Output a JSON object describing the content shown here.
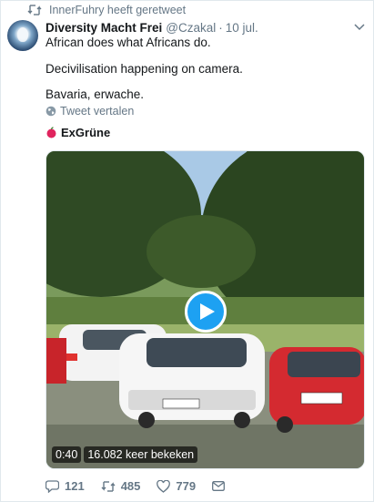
{
  "context": {
    "text": "InnerFuhry heeft geretweet",
    "icon": "retweet-icon"
  },
  "tweet": {
    "name": "Diversity Macht Frei",
    "handle": "@Czakal",
    "separator": "·",
    "date": "10 jul.",
    "lines": [
      "African does what Africans do.",
      "Decivilisation happening on camera.",
      "Bavaria, erwache."
    ],
    "translate_label": "Tweet vertalen",
    "source_label": "ExGrüne"
  },
  "video": {
    "time": "0:40",
    "views": "16.082 keer bekeken"
  },
  "actions": {
    "replies": "121",
    "retweets": "485",
    "likes": "779"
  },
  "colors": {
    "accent": "#1da1f2",
    "muted": "#657786",
    "text": "#14171a"
  }
}
